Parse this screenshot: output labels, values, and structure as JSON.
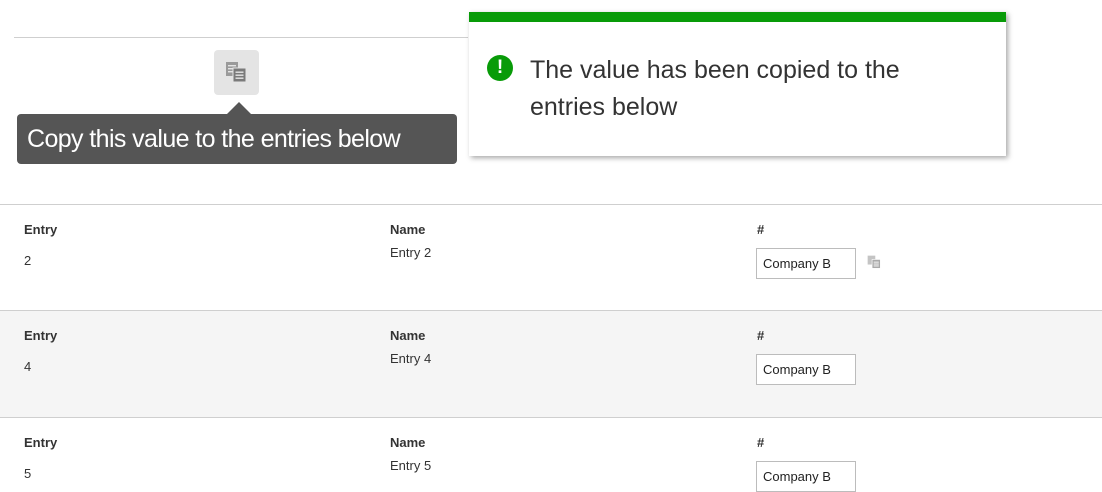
{
  "tooltip": {
    "text": "Copy this value to the entries below"
  },
  "toast": {
    "message": "The value has been copied to the entries below",
    "icon": "exclamation-circle-icon",
    "icon_glyph": "!",
    "accent_color": "#089b08"
  },
  "copy_icon": "copy-values-icon",
  "table": {
    "headers": {
      "entry": "Entry",
      "name": "Name",
      "number": "#"
    },
    "rows": [
      {
        "entry": "2",
        "name": "Entry 2",
        "value": "Company B"
      },
      {
        "entry": "4",
        "name": "Entry 4",
        "value": "Company B"
      },
      {
        "entry": "5",
        "name": "Entry 5",
        "value": "Company B"
      }
    ]
  }
}
